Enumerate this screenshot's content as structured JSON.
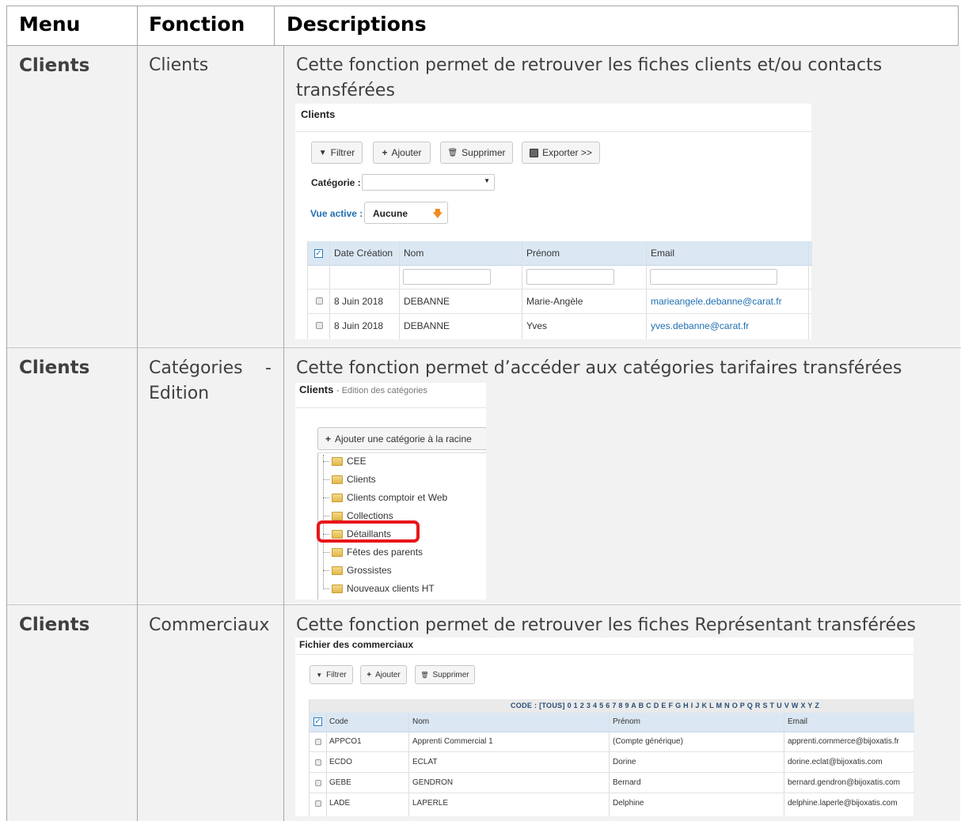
{
  "table": {
    "headers": {
      "menu": "Menu",
      "fonction": "Fonction",
      "descriptions": "Descriptions"
    },
    "rows": [
      {
        "menu": "Clients",
        "fonction": "Clients",
        "description": "Cette fonction permet de retrouver les fiches clients et/ou contacts transférées"
      },
      {
        "menu": "Clients",
        "fonction_l1": "Catégories",
        "fonction_dash": "-",
        "fonction_l2": "Edition",
        "description": "Cette fonction permet d’accéder aux catégories tarifaires transférées"
      },
      {
        "menu": "Clients",
        "fonction": "Commerciaux",
        "description": "Cette fonction permet de retrouver les fiches Représentant transférées"
      }
    ]
  },
  "clients_screen": {
    "title": "Clients",
    "buttons": {
      "filter": "Filtrer",
      "add": "Ajouter",
      "delete": "Supprimer",
      "export": "Exporter >>"
    },
    "category_label": "Catégorie :",
    "category_value": "",
    "view_label": "Vue active :",
    "view_value": "Aucune",
    "columns": [
      "Date Création",
      "Nom",
      "Prénom",
      "Email"
    ],
    "rows": [
      {
        "date": "8 Juin 2018",
        "nom": "DEBANNE",
        "prenom": "Marie-Angèle",
        "email": "marieangele.debanne@carat.fr"
      },
      {
        "date": "8 Juin 2018",
        "nom": "DEBANNE",
        "prenom": "Yves",
        "email": "yves.debanne@carat.fr"
      }
    ]
  },
  "categories_screen": {
    "title": "Clients",
    "subtitle": "- Edition des catégories",
    "add_root_button": "Ajouter une catégorie à la racine",
    "items": [
      "CEE",
      "Clients",
      "Clients comptoir et Web",
      "Collections",
      "Détaillants",
      "Fêtes des parents",
      "Grossistes",
      "Nouveaux clients HT"
    ],
    "highlighted_item": "Détaillants",
    "highlight_color": "#e8161a"
  },
  "commerciaux_screen": {
    "title": "Fichier des commerciaux",
    "buttons": {
      "filter": "Filtrer",
      "add": "Ajouter",
      "delete": "Supprimer"
    },
    "code_label": "CODE :",
    "code_all": "[TOUS]",
    "code_letters": "0 1 2 3 4 5 6 7 8 9 A B C D E F G H I J K L M N O P Q R S T U V W X Y Z",
    "columns": [
      "Code",
      "Nom",
      "Prénom",
      "Email"
    ],
    "rows": [
      {
        "code": "APPCO1",
        "nom": "Apprenti Commercial 1",
        "prenom": "(Compte générique)",
        "email": "apprenti.commerce@bijoxatis.fr"
      },
      {
        "code": "ECDO",
        "nom": "ECLAT",
        "prenom": "Dorine",
        "email": "dorine.eclat@bijoxatis.com"
      },
      {
        "code": "GEBE",
        "nom": "GENDRON",
        "prenom": "Bernard",
        "email": "bernard.gendron@bijoxatis.com"
      },
      {
        "code": "LADE",
        "nom": "LAPERLE",
        "prenom": "Delphine",
        "email": "delphine.laperle@bijoxatis.com"
      }
    ]
  },
  "colors": {
    "header_blue": "#dbe8f4",
    "link": "#1f6fb2",
    "accent_orange": "#f08a1c",
    "row_bg": "#f2f2f2",
    "border": "#a6a6a6"
  }
}
